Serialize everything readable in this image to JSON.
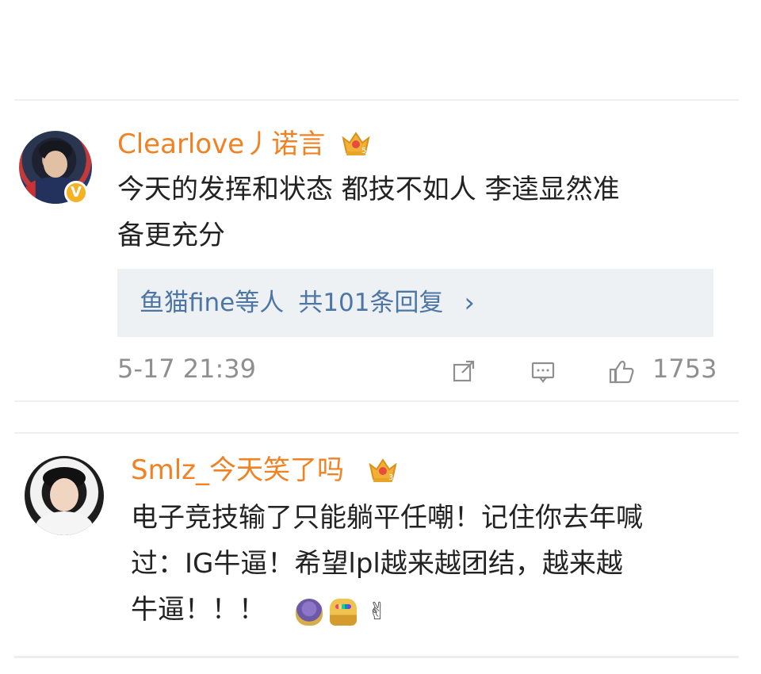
{
  "comments": [
    {
      "username": "Clearlove丿诺言",
      "badge_level": "5",
      "text": "今天的发挥和状态 都技不如人 李逵显然准\n备更充分",
      "reply_users": "鱼猫fine等人",
      "reply_count": "共101条回复",
      "reply_chevron": "›",
      "timestamp": "5-17 21:39",
      "like_count": "1753",
      "verified_symbol": "V"
    },
    {
      "username": "Smlz_今天笑了吗",
      "badge_level": "3",
      "text": "电子竞技输了只能躺平任嘲！记住你去年喊\n过：IG牛逼！希望lpl越来越团结，越来越\n牛逼！！！",
      "emojis": [
        "thanos-emoji",
        "infinity-gauntlet-emoji",
        "finger-heart-emoji"
      ],
      "finger_heart_glyph": "✌"
    }
  ],
  "colors": {
    "username": "#f08223",
    "reply_link": "#4e76a4",
    "meta_text": "#8f8f8f",
    "reply_background": "#eef1f3",
    "verified_badge": "#f7b224"
  },
  "icons": {
    "share": "share-icon",
    "comment": "comment-icon",
    "like": "like-icon",
    "crown": "crown-icon"
  }
}
